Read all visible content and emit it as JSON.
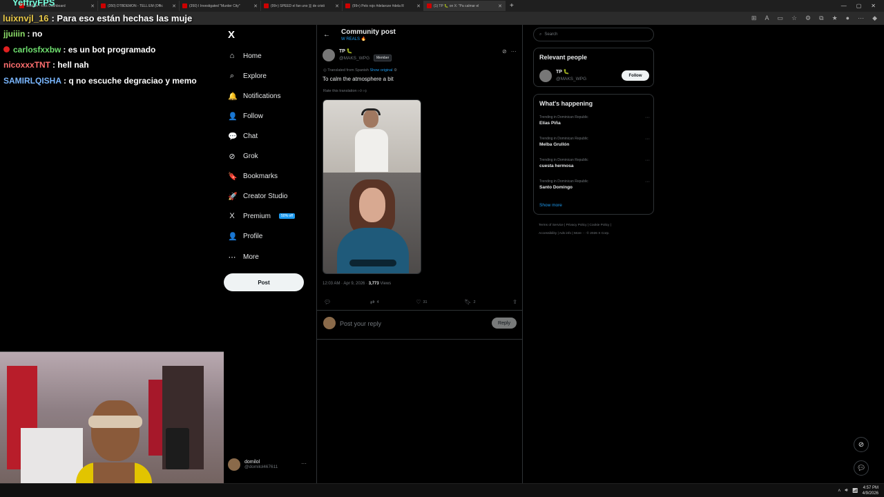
{
  "browser": {
    "tabs": [
      {
        "title": "Soldam - Kick Dashboard",
        "active": false
      },
      {
        "title": "(350) DTBDEMON - TELL EM (Offic",
        "active": false
      },
      {
        "title": "(350) I Investigated \"Murder City\"",
        "active": false
      },
      {
        "title": "(99+) SPEED el fan uno 🇩 de cristi",
        "active": false
      },
      {
        "title": "(99+) Pelo rojo #delaroze #dela R",
        "active": false
      },
      {
        "title": "(1) TP 🐛 on X: \"Pa calmar el",
        "active": true
      }
    ],
    "new_tab": "+"
  },
  "stream_overlay": {
    "channel_name": "YeffryFPS",
    "highlight": {
      "user": "luixnvjl_16",
      "text": ": Para eso están hechas las muje"
    },
    "chat": [
      {
        "user": "jjuiiin",
        "text": ": no",
        "color": "#8ee06a",
        "dot": false
      },
      {
        "user": "carlosfxxbw",
        "text": ": es un bot programado",
        "color": "#6fe06f",
        "dot": true
      },
      {
        "user": "nicoxxxTNT",
        "text": ": hell nah",
        "color": "#ff6f6f",
        "dot": false
      },
      {
        "user": "SAMIRLQISHA",
        "text": ": q no escuche degraciao y memo",
        "color": "#7ab7ff",
        "dot": false
      }
    ]
  },
  "x_nav": {
    "logo": "X",
    "items": [
      {
        "label": "Home",
        "icon": "home-icon",
        "glyph": "⌂"
      },
      {
        "label": "Explore",
        "icon": "search-icon",
        "glyph": "⌕"
      },
      {
        "label": "Notifications",
        "icon": "bell-icon",
        "glyph": "🔔"
      },
      {
        "label": "Follow",
        "icon": "person-add-icon",
        "glyph": "👤"
      },
      {
        "label": "Chat",
        "icon": "chat-icon",
        "glyph": "💬"
      },
      {
        "label": "Grok",
        "icon": "grok-icon",
        "glyph": "⊘"
      },
      {
        "label": "Bookmarks",
        "icon": "bookmark-icon",
        "glyph": "🔖"
      },
      {
        "label": "Creator Studio",
        "icon": "rocket-icon",
        "glyph": "🚀"
      },
      {
        "label": "Premium",
        "icon": "x-premium-icon",
        "glyph": "X"
      },
      {
        "label": "Profile",
        "icon": "profile-icon",
        "glyph": "👤"
      },
      {
        "label": "More",
        "icon": "more-circle-icon",
        "glyph": "⋯"
      }
    ],
    "premium_badge": "50% off",
    "post_button": "Post",
    "account": {
      "name": "domilol",
      "handle": "@domilol467611"
    }
  },
  "post": {
    "header_title": "Community post",
    "community": "W REALS 🔥",
    "author_name": "TP 🐛",
    "author_handle": "@MAKS_WPG",
    "member_badge": "Member",
    "translated_note": "Translated from Spanish",
    "show_original": "Show original",
    "text": "To calm the atmosphere a bit",
    "rate_translation": "Rate this translation",
    "time": "12:03 AM · Apr 9, 2026 · ",
    "views_count": "3,773",
    "views_label": " Views",
    "replies": "",
    "reposts": "4",
    "likes": "31",
    "bookmarks": "2"
  },
  "reply": {
    "placeholder": "Post your reply",
    "button": "Reply"
  },
  "sidebar": {
    "search_placeholder": "Search",
    "relevant_people_title": "Relevant people",
    "relevant_person": {
      "name": "TP 🐛",
      "handle": "@MAKS_WPG"
    },
    "follow_button": "Follow",
    "whats_happening_title": "What's happening",
    "trends": [
      {
        "context": "Trending in Dominican Republic",
        "title": "Elías Piña"
      },
      {
        "context": "Trending in Dominican Republic",
        "title": "Melba Grullón"
      },
      {
        "context": "Trending in Dominican Republic",
        "title": "cuesta hermosa"
      },
      {
        "context": "Trending in Dominican Republic",
        "title": "Santo Domingo"
      }
    ],
    "show_more": "Show more",
    "footer_line1": "Terms of Service  |  Privacy Policy  |  Cookie Policy  |",
    "footer_line2": "Accessibility  |  Ads info  |  More ···  © 2026 X Corp."
  },
  "taskbar": {
    "time": "4:57 PM",
    "date": "4/9/2026"
  }
}
